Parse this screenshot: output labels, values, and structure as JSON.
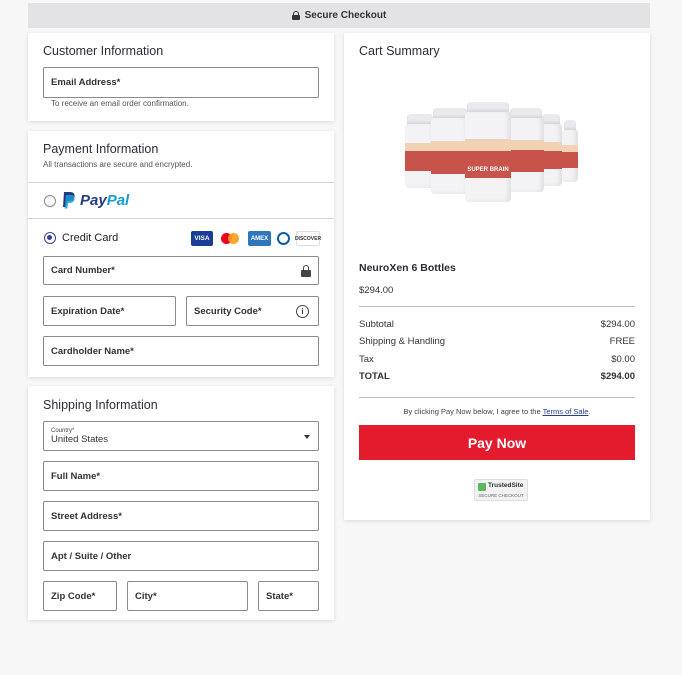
{
  "topbar": {
    "label": "Secure Checkout"
  },
  "customer": {
    "title": "Customer Information",
    "email_placeholder": "Email Address*",
    "email_hint": "To receive an email order confirmation."
  },
  "payment": {
    "title": "Payment Information",
    "subtitle": "All transactions are secure and encrypted.",
    "paypal_logo_pay": "Pay",
    "paypal_logo_pal": "Pal",
    "credit_card_label": "Credit Card",
    "card_icons": [
      "VISA",
      "mastercard",
      "AMEX",
      "diners",
      "DISCOVER"
    ],
    "card_number_placeholder": "Card Number*",
    "expiration_placeholder": "Expiration Date*",
    "security_code_placeholder": "Security Code*",
    "cardholder_placeholder": "Cardholder Name*"
  },
  "shipping": {
    "title": "Shipping Information",
    "country_label": "Country*",
    "country_value": "United States",
    "full_name_placeholder": "Full Name*",
    "street_placeholder": "Street Address*",
    "apt_placeholder": "Apt / Suite / Other",
    "zip_placeholder": "Zip Code*",
    "city_placeholder": "City*",
    "state_placeholder": "State*"
  },
  "cart": {
    "title": "Cart Summary",
    "product_image_text": "SUPER BRAIN",
    "product_name": "NeuroXen 6 Bottles",
    "product_price": "$294.00",
    "rows": [
      {
        "label": "Subtotal",
        "value": "$294.00"
      },
      {
        "label": "Shipping & Handling",
        "value": "FREE"
      },
      {
        "label": "Tax",
        "value": "$0.00"
      },
      {
        "label": "TOTAL",
        "value": "$294.00"
      }
    ],
    "terms_prefix": "By clicking Pay Now below, I agree to the ",
    "terms_link": "Terms of Sale",
    "terms_suffix": ".",
    "pay_button": "Pay Now",
    "trust_badge_title": "TrustedSite",
    "trust_badge_sub": "SECURE CHECKOUT"
  },
  "colors": {
    "accent_red": "#e31b2d",
    "radio_selected": "#3b3f8f",
    "paypal_dark": "#253b80",
    "paypal_light": "#179bd7"
  }
}
